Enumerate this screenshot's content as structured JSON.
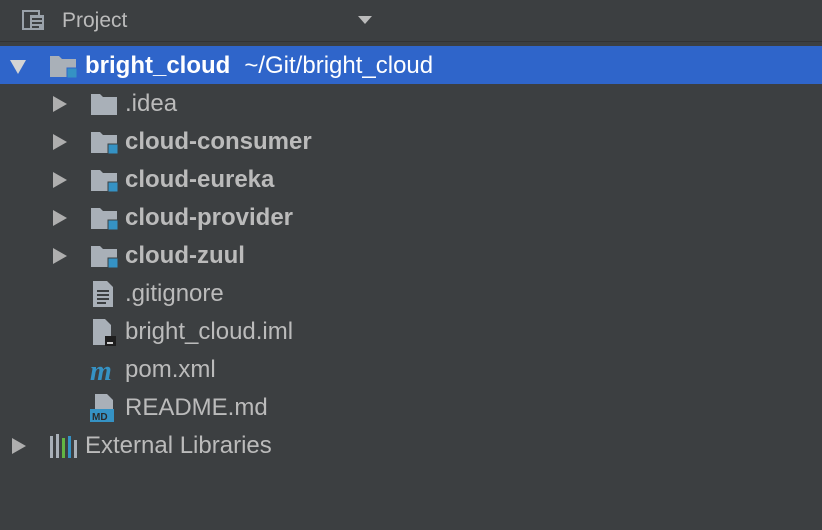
{
  "header": {
    "title": "Project",
    "icon": "project-view-icon",
    "dropdown_icon": "dropdown-caret-icon"
  },
  "tree": {
    "root": {
      "name": "bright_cloud",
      "path": "~/Git/bright_cloud",
      "icon": "module-folder-icon",
      "expanded": true,
      "selected": true
    },
    "children": [
      {
        "name": ".idea",
        "icon": "folder-icon",
        "expandable": true,
        "bold": false
      },
      {
        "name": "cloud-consumer",
        "icon": "module-folder-icon",
        "expandable": true,
        "bold": true
      },
      {
        "name": "cloud-eureka",
        "icon": "module-folder-icon",
        "expandable": true,
        "bold": true
      },
      {
        "name": "cloud-provider",
        "icon": "module-folder-icon",
        "expandable": true,
        "bold": true
      },
      {
        "name": "cloud-zuul",
        "icon": "module-folder-icon",
        "expandable": true,
        "bold": true
      },
      {
        "name": ".gitignore",
        "icon": "text-file-icon",
        "expandable": false,
        "bold": false
      },
      {
        "name": "bright_cloud.iml",
        "icon": "iml-file-icon",
        "expandable": false,
        "bold": false
      },
      {
        "name": "pom.xml",
        "icon": "maven-icon",
        "expandable": false,
        "bold": false
      },
      {
        "name": "README.md",
        "icon": "markdown-file-icon",
        "expandable": false,
        "bold": false
      }
    ],
    "external": {
      "name": "External Libraries",
      "icon": "libraries-icon",
      "expandable": true
    }
  },
  "colors": {
    "background": "#3c3f41",
    "selection": "#2f65ca",
    "text": "#bbbbbb",
    "folder": "#a9b0b8",
    "module_badge": "#3592c4",
    "maven": "#3592c4"
  }
}
